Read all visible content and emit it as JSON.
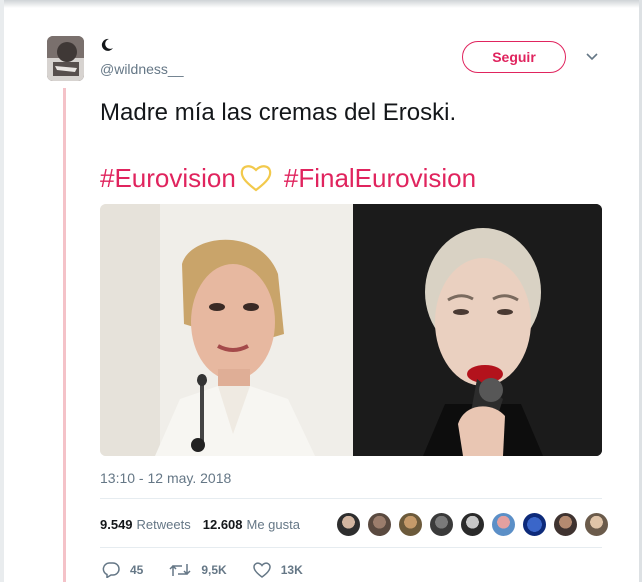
{
  "user": {
    "display_name_icon": "crescent-moon-icon",
    "handle": "@wildness__"
  },
  "follow_label": "Seguir",
  "tweet": {
    "text": "Madre mía las cremas del Eroski.",
    "hashtag_1": "#Eurovision",
    "hashtag_2": "#FinalEurovision"
  },
  "timestamp": "13:10 - 12 may. 2018",
  "stats": {
    "retweets_count": "9.549",
    "retweets_label": "Retweets",
    "likes_count": "12.608",
    "likes_label": "Me gusta"
  },
  "actions": {
    "replies": "45",
    "retweets": "9,5K",
    "likes": "13K"
  },
  "colors": {
    "accent": "#e0245e",
    "heart_emoji": "#f2c94c",
    "muted": "#657786",
    "text": "#14171a",
    "thread": "#f4c2c8"
  }
}
